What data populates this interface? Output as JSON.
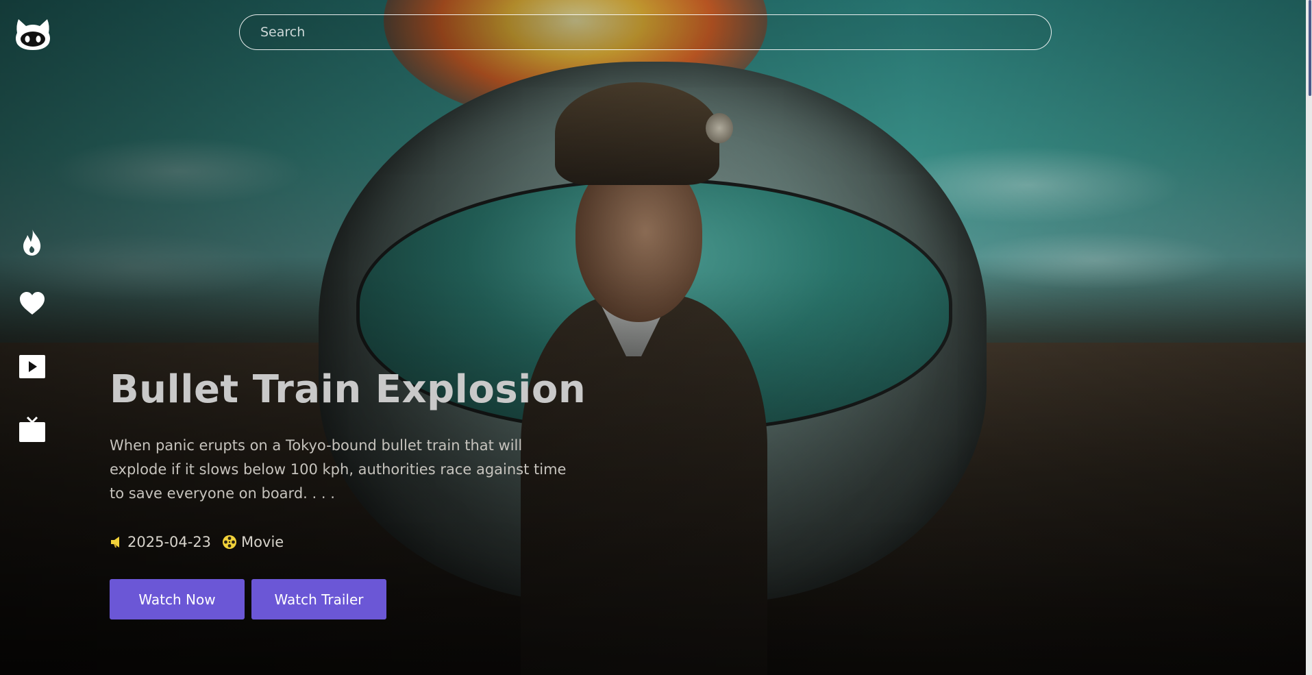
{
  "search": {
    "placeholder": "Search"
  },
  "sidebar": {
    "items": [
      {
        "icon": "flame-icon"
      },
      {
        "icon": "heart-icon"
      },
      {
        "icon": "play-icon"
      },
      {
        "icon": "tv-icon"
      }
    ]
  },
  "hero": {
    "title": "Bullet Train Explosion",
    "description": "When panic erupts on a Tokyo-bound bullet train that will explode if it slows below 100 kph, authorities race against time to save everyone on board. . . .",
    "release_date": "2025-04-23",
    "media_type": "Movie",
    "watch_now_label": "Watch Now",
    "watch_trailer_label": "Watch Trailer"
  },
  "colors": {
    "accent": "#6b57d6",
    "meta_icon": "#f2d23a"
  }
}
